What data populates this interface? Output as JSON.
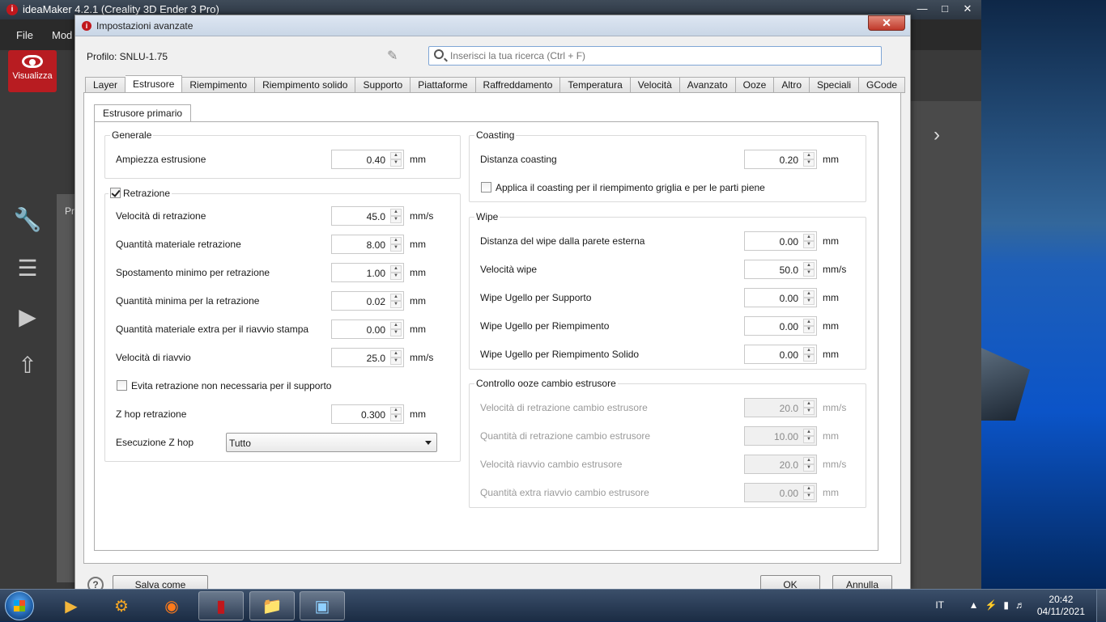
{
  "app": {
    "title": "ideaMaker 4.2.1 (Creality 3D Ender 3 Pro)",
    "menu": [
      "File",
      "Mod"
    ],
    "view_button": "Visualizza",
    "panel_label": "Pr"
  },
  "dialog": {
    "title": "Impostazioni avanzate",
    "profile": "Profilo: SNLU-1.75",
    "search_placeholder": "Inserisci la tua ricerca (Ctrl + F)",
    "tabs": [
      "Layer",
      "Estrusore",
      "Riempimento",
      "Riempimento solido",
      "Supporto",
      "Piattaforme",
      "Raffreddamento",
      "Temperatura",
      "Velocità",
      "Avanzato",
      "Ooze",
      "Altro",
      "Speciali",
      "GCode"
    ],
    "active_tab": "Estrusore",
    "subtab": "Estrusore primario",
    "generale": {
      "label": "Generale",
      "rows": [
        {
          "label": "Ampiezza estrusione",
          "value": "0.40",
          "unit": "mm"
        }
      ]
    },
    "retrazione": {
      "label": "Retrazione",
      "checked": true,
      "rows": [
        {
          "label": "Velocità di retrazione",
          "value": "45.0",
          "unit": "mm/s"
        },
        {
          "label": "Quantità materiale retrazione",
          "value": "8.00",
          "unit": "mm"
        },
        {
          "label": "Spostamento minimo per retrazione",
          "value": "1.00",
          "unit": "mm"
        },
        {
          "label": "Quantità minima per la retrazione",
          "value": "0.02",
          "unit": "mm"
        },
        {
          "label": "Quantità materiale extra per il riavvio stampa",
          "value": "0.00",
          "unit": "mm"
        },
        {
          "label": "Velocità di riavvio",
          "value": "25.0",
          "unit": "mm/s"
        }
      ],
      "avoid_support": "Evita retrazione non necessaria per il supporto",
      "zhop": {
        "label": "Z hop retrazione",
        "value": "0.300",
        "unit": "mm"
      },
      "zhop_exec": {
        "label": "Esecuzione Z hop",
        "value": "Tutto"
      }
    },
    "coasting": {
      "label": "Coasting",
      "rows": [
        {
          "label": "Distanza coasting",
          "value": "0.20",
          "unit": "mm"
        }
      ],
      "apply": "Applica il coasting per il riempimento griglia e per le parti piene"
    },
    "wipe": {
      "label": "Wipe",
      "rows": [
        {
          "label": "Distanza del wipe dalla parete esterna",
          "value": "0.00",
          "unit": "mm"
        },
        {
          "label": "Velocità wipe",
          "value": "50.0",
          "unit": "mm/s"
        },
        {
          "label": "Wipe Ugello per Supporto",
          "value": "0.00",
          "unit": "mm"
        },
        {
          "label": "Wipe Ugello per Riempimento",
          "value": "0.00",
          "unit": "mm"
        },
        {
          "label": "Wipe Ugello per Riempimento Solido",
          "value": "0.00",
          "unit": "mm"
        }
      ]
    },
    "ooze": {
      "label": "Controllo ooze cambio estrusore",
      "rows": [
        {
          "label": "Velocità di retrazione cambio estrusore",
          "value": "20.0",
          "unit": "mm/s"
        },
        {
          "label": "Quantità di retrazione cambio estrusore",
          "value": "10.00",
          "unit": "mm"
        },
        {
          "label": "Velocità riavvio cambio estrusore",
          "value": "20.0",
          "unit": "mm/s"
        },
        {
          "label": "Quantità extra riavvio cambio estrusore",
          "value": "0.00",
          "unit": "mm"
        }
      ]
    },
    "buttons": {
      "help": "?",
      "save_as": "Salva come",
      "ok": "OK",
      "cancel": "Annulla"
    }
  },
  "taskbar": {
    "lang": "IT",
    "time": "20:42",
    "date": "04/11/2021"
  }
}
